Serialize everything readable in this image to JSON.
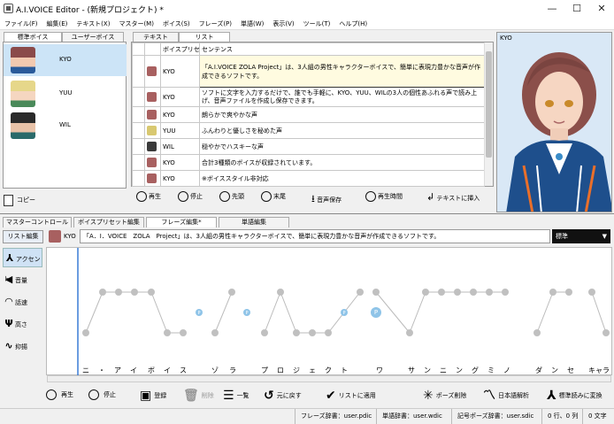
{
  "window": {
    "title": "A.I.VOICE Editor - (新規プロジェクト) *",
    "min": "—",
    "max": "☐",
    "close": "✕"
  },
  "menu": [
    "ファイル(F)",
    "編集(E)",
    "テキスト(X)",
    "マスター(M)",
    "ボイス(S)",
    "フレーズ(P)",
    "単語(W)",
    "表示(V)",
    "ツール(T)",
    "ヘルプ(H)"
  ],
  "voice_panel": {
    "tabs": [
      "標準ボイス",
      "ユーザーボイス"
    ],
    "voices": [
      "KYO",
      "YUU",
      "WIL"
    ],
    "copy_label": "コピー"
  },
  "list_panel": {
    "tabs": [
      "テキスト",
      "リスト"
    ],
    "headers": [
      "ボイスプリセット",
      "センテンス"
    ],
    "rows": [
      {
        "preset": "KYO",
        "text": "「A.I.VOICE ZOLA Project」は、3人組の男性キャラクターボイスで、簡単に表現力豊かな音声が作成できるソフトです。"
      },
      {
        "preset": "KYO",
        "text": "ソフトに文字を入力するだけで、誰でも手軽に、KYO、YUU、WILの3人の個性あふれる声で読み上げ、音声ファイルを作成し保存できます。"
      },
      {
        "preset": "KYO",
        "text": "朗らかで爽やかな声"
      },
      {
        "preset": "YUU",
        "text": "ふんわりと優しさを秘めた声"
      },
      {
        "preset": "WIL",
        "text": "穏やかでハスキーな声"
      },
      {
        "preset": "KYO",
        "text": "合計3種類のボイスが収録されています。"
      },
      {
        "preset": "KYO",
        "text": "※ボイススタイル非対応"
      }
    ],
    "toolbar": [
      "再生",
      "停止",
      "先頭",
      "末尾",
      "音声保存",
      "再生時間",
      "テキストに挿入"
    ]
  },
  "character": {
    "name": "KYO"
  },
  "editor": {
    "tabs": [
      "マスターコントロール",
      "ボイスプリセット編集",
      "フレーズ編集*",
      "単語編集"
    ],
    "list_edit": "リスト編集",
    "side": [
      "アクセント",
      "音量",
      "話速",
      "高さ",
      "抑揚"
    ],
    "phrase": "「A．I．VOICE　ZOLA　Project」は、3人組の男性キャラクターボイスで、簡単に表現力豊かな音声が作成できるソフトです。",
    "phrase_voice": "KYO",
    "mode": "標準",
    "kana": [
      "ニ",
      "・",
      "ア",
      "イ",
      "ボ",
      "イ",
      "ス",
      "",
      "ゾ",
      "ラ",
      "",
      "プ",
      "ロ",
      "ジ",
      "ェ",
      "ク",
      "ト",
      "",
      "ワ",
      "",
      "サ",
      "ン",
      "ニ",
      "ン",
      "グ",
      "ミ",
      "ノ",
      "",
      "ダ",
      "ン",
      "セ",
      "",
      "キャ",
      "ラ"
    ],
    "pause_labels": [
      "P",
      "P",
      "P",
      "P"
    ],
    "bottom": [
      "再生",
      "停止",
      "登録",
      "削除",
      "一覧",
      "元に戻す",
      "リストに適用",
      "ポーズ削除",
      "日本語解析",
      "標準読みに変換"
    ]
  },
  "status": [
    "フレーズ辞書：user.pdic",
    "単語辞書：user.wdic",
    "記号ポーズ辞書：user.sdic",
    "0 行、0 列",
    "0 文字"
  ]
}
